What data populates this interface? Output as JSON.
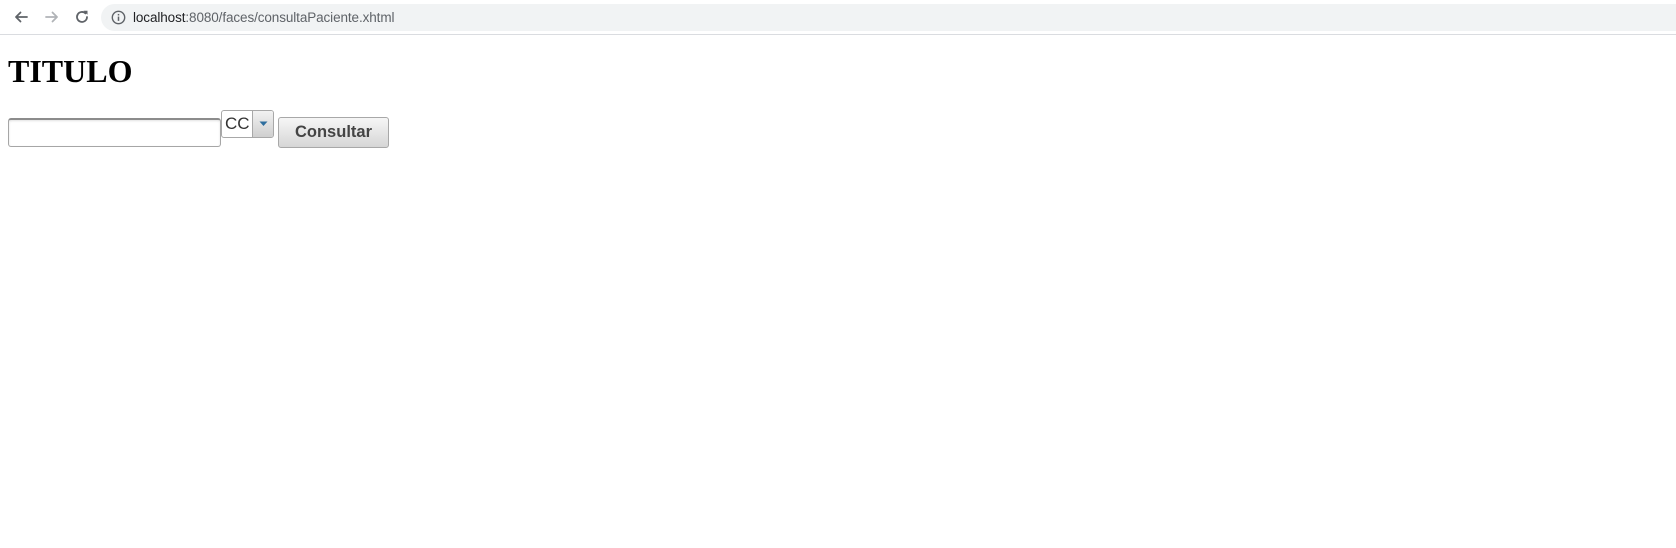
{
  "browser": {
    "url_host": "localhost",
    "url_path": ":8080/faces/consultaPaciente.xhtml",
    "icons": {
      "back": "arrow-left-icon",
      "forward": "arrow-right-icon",
      "reload": "reload-icon",
      "site_info": "info-icon"
    }
  },
  "page": {
    "title": "TITULO",
    "document_input": {
      "value": "",
      "placeholder": ""
    },
    "document_type_select": {
      "selected": "CC"
    },
    "consult_button": {
      "label": "Consultar"
    }
  },
  "colors": {
    "omnibox_bg": "#f1f3f4",
    "button_text": "#444444",
    "dropdown_arrow": "#2e6e9e"
  }
}
